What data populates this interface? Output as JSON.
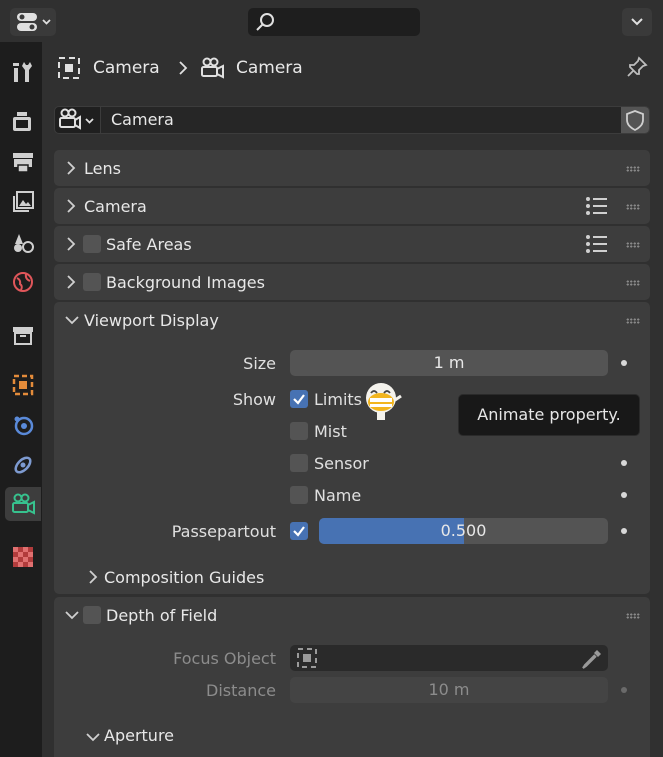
{
  "breadcrumb": {
    "object": "Camera",
    "data": "Camera"
  },
  "datablock": {
    "name": "Camera"
  },
  "panels": {
    "lens": {
      "title": "Lens"
    },
    "camera": {
      "title": "Camera"
    },
    "safe_areas": {
      "title": "Safe Areas",
      "enabled": false
    },
    "background_images": {
      "title": "Background Images",
      "enabled": false
    },
    "viewport_display": {
      "title": "Viewport Display",
      "size_label": "Size",
      "size_value": "1 m",
      "show_label": "Show",
      "limits": "Limits",
      "limits_checked": true,
      "mist": "Mist",
      "mist_checked": false,
      "sensor": "Sensor",
      "sensor_checked": false,
      "name": "Name",
      "name_checked": false,
      "passepartout_label": "Passepartout",
      "passepartout_checked": true,
      "passepartout_value": "0.500",
      "passepartout_fraction": 0.5,
      "composition_guides": "Composition Guides"
    },
    "depth_of_field": {
      "title": "Depth of Field",
      "enabled": false,
      "focus_object_label": "Focus Object",
      "distance_label": "Distance",
      "distance_value": "10 m",
      "aperture": "Aperture"
    }
  },
  "tooltip": {
    "text": "Animate property."
  },
  "colors": {
    "accent": "#4772b3",
    "active_tab_icon": "#37c28e",
    "background": "#303030"
  }
}
